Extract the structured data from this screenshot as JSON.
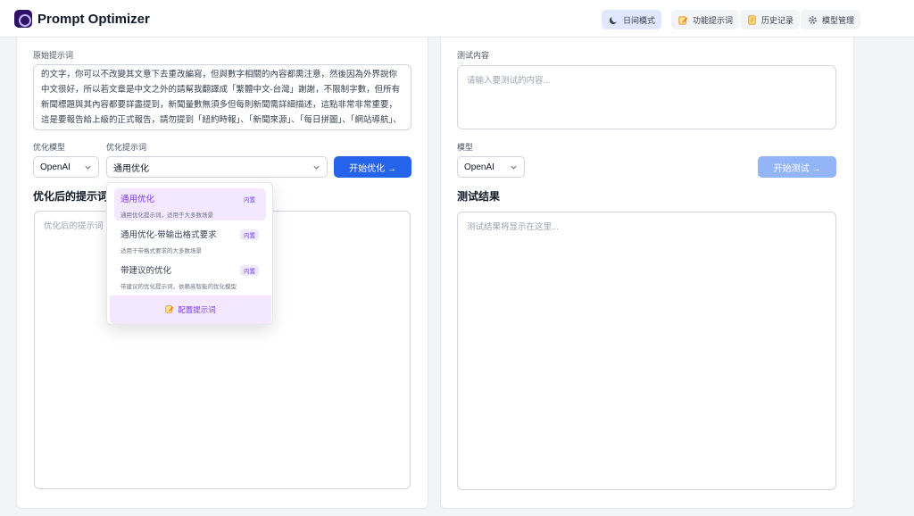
{
  "app": {
    "title": "Prompt Optimizer"
  },
  "nav": [
    {
      "label": "日间模式",
      "icon": "moon-icon"
    },
    {
      "label": "功能提示词",
      "icon": "edit-icon"
    },
    {
      "label": "历史记录",
      "icon": "history-icon"
    },
    {
      "label": "模型管理",
      "icon": "gear-icon"
    }
  ],
  "left": {
    "original_label": "原始提示词",
    "original_text": "的文字，你可以不改變其文意下去重改編寫，但與數字相關的內容都需注意，然後因為外界說你中文很好，所以若文章是中文之外的請幫我翻譯成「繁體中文-台灣」謝謝，不限制字數，但所有新聞標題與其內容都要詳盡提到，新聞量數無須多但每則新聞需詳細描述，這點非常非常重要，這是要報告給上級的正式報告，請勿提到「紐約時報」、「新聞來源」、「每日拼圖」、「網站導航」、「今日天氣」等字眼，也無須解釋您怎麼思考，",
    "model_label": "优化模型",
    "model_value": "OpenAI",
    "template_label": "优化提示词",
    "template_value": "通用优化",
    "optimize_button": "开始优化 →",
    "result_title": "优化后的提示词",
    "result_placeholder": "优化后的提示词"
  },
  "dropdown": {
    "items": [
      {
        "name": "通用优化",
        "desc": "通用优化提示词，适用于大多数场景",
        "badge": "内置"
      },
      {
        "name": "通用优化-带输出格式要求",
        "desc": "适用于带格式要求的大多数场景",
        "badge": "内置"
      },
      {
        "name": "带建议的优化",
        "desc": "带建议的优化提示词，依赖高智能的优化模型",
        "badge": "内置"
      }
    ],
    "footer": "配置提示词"
  },
  "right": {
    "test_label": "测试内容",
    "test_placeholder": "请输入要测试的内容...",
    "model_label": "模型",
    "model_value": "OpenAI",
    "test_button": "开始测试 →",
    "result_title": "测试结果",
    "result_placeholder": "测试结果将显示在这里..."
  },
  "colors": {
    "primary": "#2563eb",
    "primary_disabled": "#93b4f6",
    "accent": "#7c3aed",
    "accent_bg": "#f3e8ff",
    "logo": "#2e1065"
  }
}
